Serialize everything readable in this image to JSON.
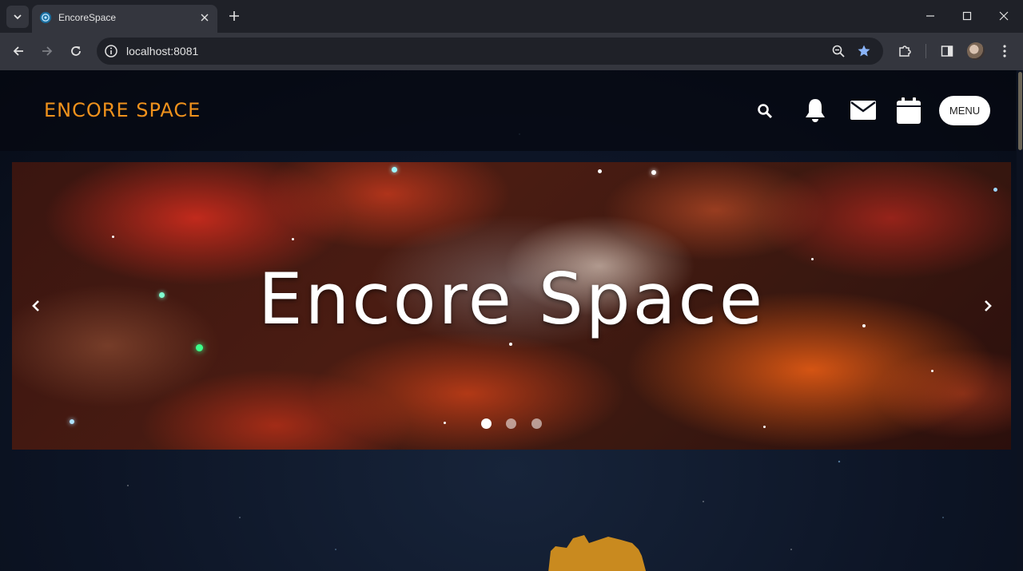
{
  "browser": {
    "tab_title": "EncoreSpace",
    "url": "localhost:8081"
  },
  "header": {
    "logo": "ENCORE SPACE",
    "menu_label": "MENU"
  },
  "carousel": {
    "title": "Encore Space",
    "slide_count": 3,
    "active_slide": 1
  },
  "colors": {
    "brand_orange": "#f0921c",
    "browser_bg": "#1f2128",
    "toolbar_bg": "#34363e",
    "page_bg": "#0d1526",
    "star_accent": "#8ab4f8"
  },
  "icons": {
    "header": [
      "search-icon",
      "bell-icon",
      "mail-icon",
      "calendar-icon"
    ],
    "carousel": [
      "chevron-left-icon",
      "chevron-right-icon"
    ]
  }
}
